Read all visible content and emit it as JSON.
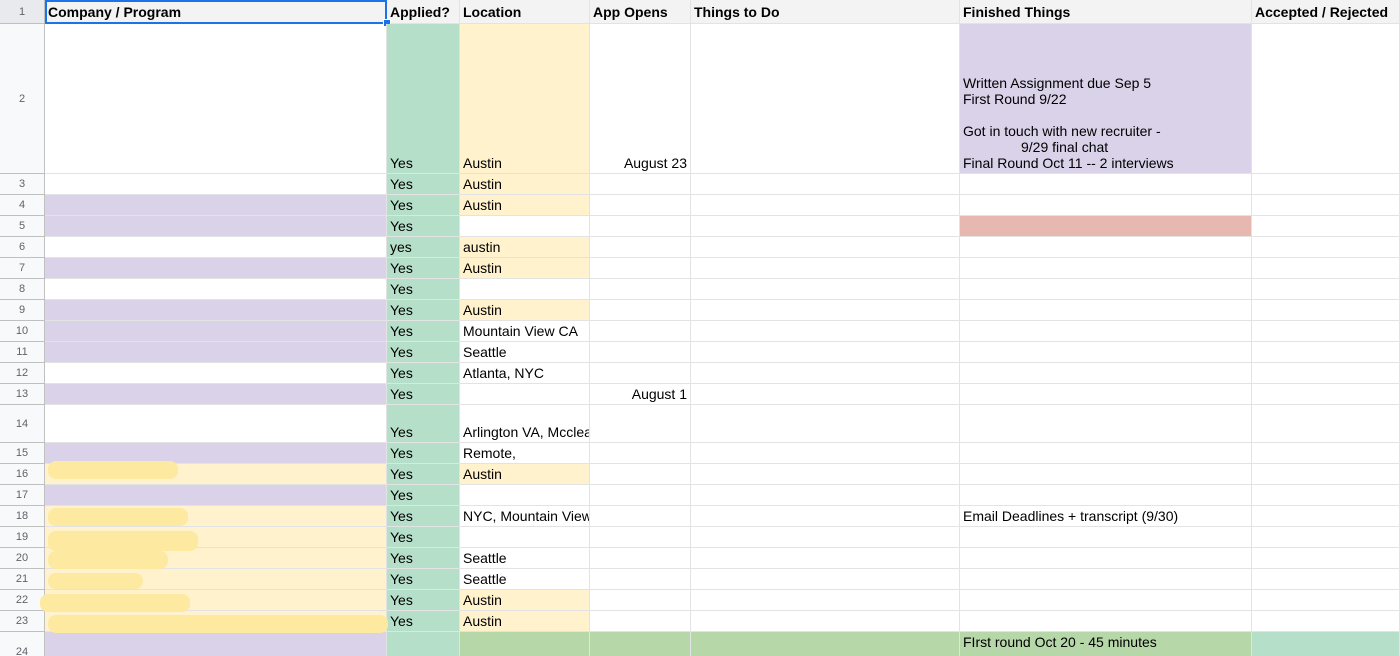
{
  "headers": {
    "row_label": "1",
    "company": "Company / Program",
    "applied": "Applied?",
    "location": "Location",
    "app_opens": "App Opens",
    "things_to_do": "Things to Do",
    "finished": "Finished Things",
    "accepted": "Accepted / Rejected"
  },
  "colors": {
    "purple": "#d9d2e9",
    "green": "#b6dfca",
    "yellow": "#fff2cc",
    "red": "#e6b8af",
    "dark_green": "#b6d7a8",
    "highlight": "#fde9a0"
  },
  "rows": [
    {
      "n": "2",
      "applied": "Yes",
      "location": "Austin",
      "opens": "August 23",
      "finished": [
        "Written Assignment due Sep 5",
        "First Round 9/22",
        "Got in touch with new recruiter -",
        "9/29 final chat",
        "Final Round Oct 11 -- 2 interviews"
      ]
    },
    {
      "n": "3",
      "applied": "Yes",
      "location": "Austin"
    },
    {
      "n": "4",
      "applied": "Yes",
      "location": "Austin"
    },
    {
      "n": "5",
      "applied": "Yes",
      "location": ""
    },
    {
      "n": "6",
      "applied": "yes",
      "location": "austin"
    },
    {
      "n": "7",
      "applied": "Yes",
      "location": "Austin"
    },
    {
      "n": "8",
      "applied": "Yes",
      "location": ""
    },
    {
      "n": "9",
      "applied": "Yes",
      "location": "Austin"
    },
    {
      "n": "10",
      "applied": "Yes",
      "location": "Mountain View CA"
    },
    {
      "n": "11",
      "applied": "Yes",
      "location": "Seattle"
    },
    {
      "n": "12",
      "applied": "Yes",
      "location": "Atlanta, NYC"
    },
    {
      "n": "13",
      "applied": "Yes",
      "location": "",
      "opens": "August 1"
    },
    {
      "n": "14",
      "applied": "Yes",
      "location": "Arlington VA, Mcclean"
    },
    {
      "n": "15",
      "applied": "Yes",
      "location": "Remote,"
    },
    {
      "n": "16",
      "applied": "Yes",
      "location": "Austin"
    },
    {
      "n": "17",
      "applied": "Yes",
      "location": ""
    },
    {
      "n": "18",
      "applied": "Yes",
      "location": "NYC, Mountain View",
      "finished_single": "Email Deadlines + transcript (9/30)"
    },
    {
      "n": "19",
      "applied": "Yes",
      "location": ""
    },
    {
      "n": "20",
      "applied": "Yes",
      "location": "Seattle"
    },
    {
      "n": "21",
      "applied": "Yes",
      "location": "Seattle"
    },
    {
      "n": "22",
      "applied": "Yes",
      "location": "Austin"
    },
    {
      "n": "23",
      "applied": "Yes",
      "location": "Austin"
    },
    {
      "n": "24",
      "applied": "",
      "location": "",
      "finished_single": "FIrst round Oct 20 - 45 minutes"
    }
  ]
}
